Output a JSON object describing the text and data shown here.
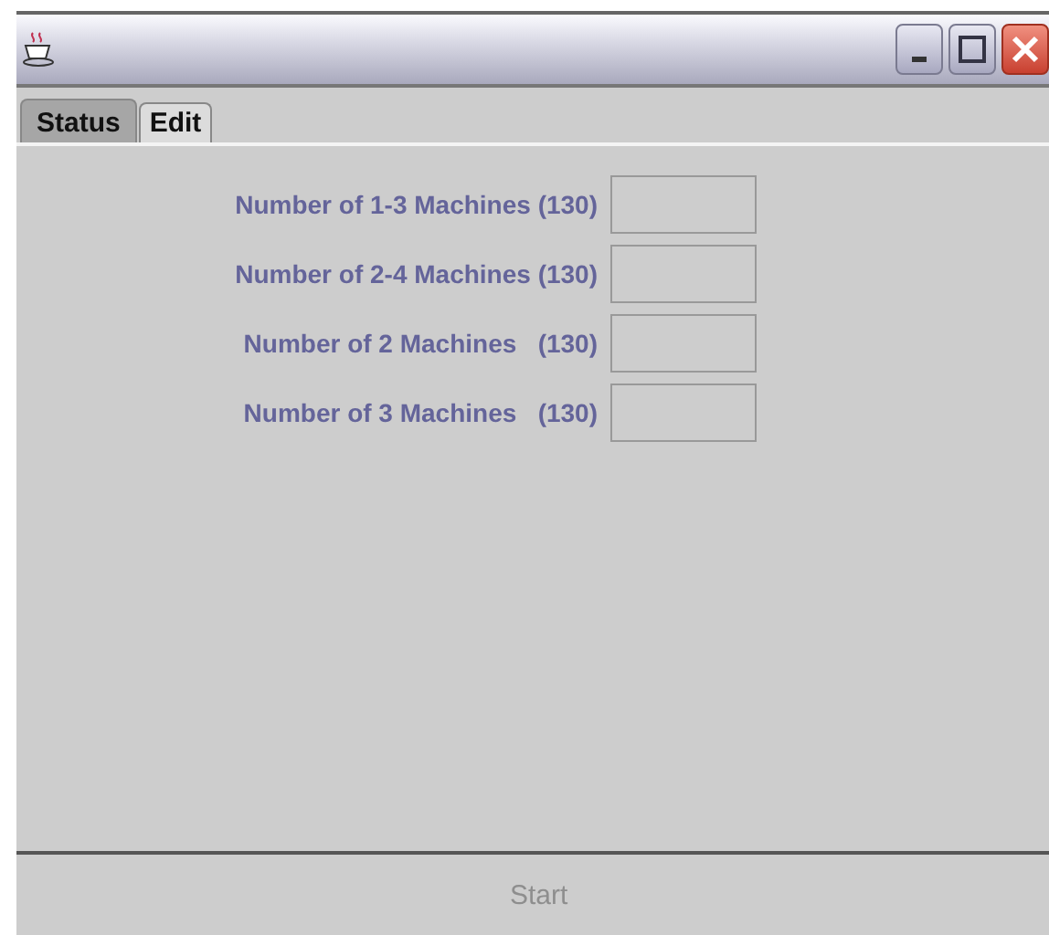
{
  "tabs": [
    {
      "label": "Status",
      "selected": true
    },
    {
      "label": "Edit",
      "selected": false
    }
  ],
  "fields": [
    {
      "label": "Number of 1-3 Machines (130)"
    },
    {
      "label": "Number of 2-4 Machines (130)"
    },
    {
      "label": "Number of 2 Machines   (130)"
    },
    {
      "label": "Number of 3 Machines   (130)"
    }
  ],
  "start_button": {
    "label": "Start",
    "disabled": true
  }
}
